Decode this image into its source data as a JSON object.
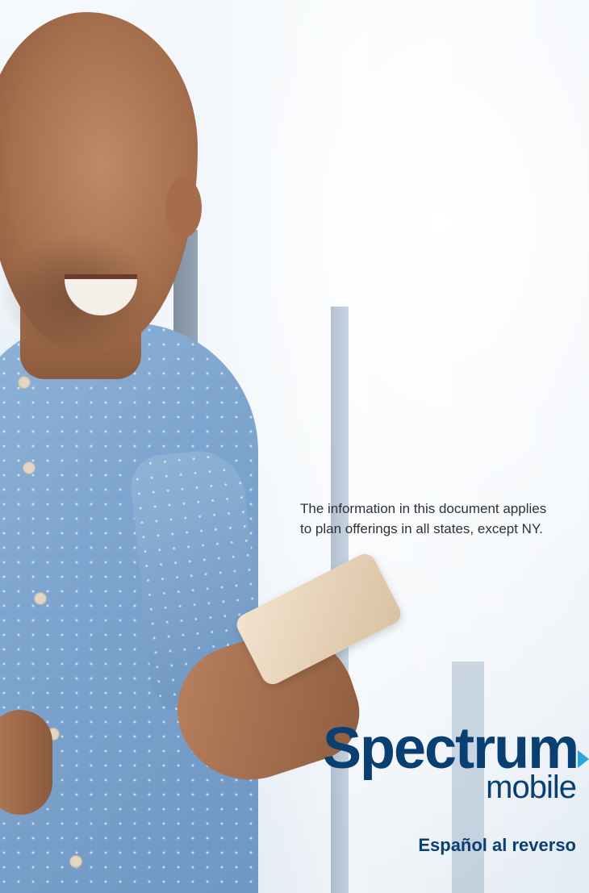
{
  "notice": {
    "line1": "The information in this document applies",
    "line2": "to plan offerings in all states, except NY."
  },
  "brand": {
    "name": "Spectrum",
    "sub": "mobile",
    "primary_color": "#0a3f72",
    "accent_color": "#2aa6dd"
  },
  "footer": {
    "language_note": "Español al reverso"
  },
  "photo": {
    "description_icon": "photo-man-smartphone"
  }
}
